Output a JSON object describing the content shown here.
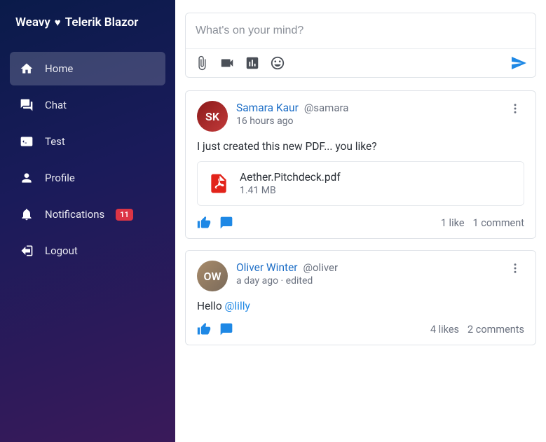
{
  "brand": {
    "left": "Weavy",
    "right": "Telerik Blazor"
  },
  "sidebar": {
    "items": [
      {
        "label": "Home"
      },
      {
        "label": "Chat"
      },
      {
        "label": "Test"
      },
      {
        "label": "Profile"
      },
      {
        "label": "Notifications",
        "badge": "11"
      },
      {
        "label": "Logout"
      }
    ]
  },
  "composer": {
    "placeholder": "What's on your mind?"
  },
  "posts": [
    {
      "author": "Samara Kaur",
      "handle": "@samara",
      "timestamp": "16 hours ago",
      "body": "I just created this new PDF... you like?",
      "attachment": {
        "name": "Aether.Pitchdeck.pdf",
        "size": "1.41 MB"
      },
      "likes": "1 like",
      "comments": "1 comment"
    },
    {
      "author": "Oliver Winter",
      "handle": "@oliver",
      "timestamp": "a day ago · edited",
      "body_prefix": "Hello ",
      "mention": "@lilly",
      "likes": "4 likes",
      "comments": "2 comments"
    }
  ]
}
